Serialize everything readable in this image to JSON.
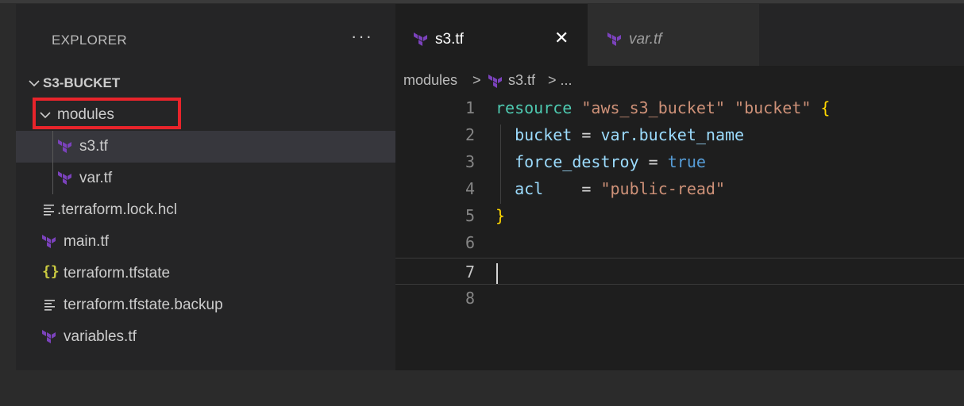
{
  "sidebar": {
    "title": "EXPLORER",
    "more_label": "···",
    "root_folder": "S3-BUCKET",
    "tree": [
      {
        "label": "modules",
        "kind": "folder",
        "expanded": true,
        "highlighted": true
      },
      {
        "label": "s3.tf",
        "kind": "terraform",
        "selected": true
      },
      {
        "label": "var.tf",
        "kind": "terraform"
      },
      {
        "label": ".terraform.lock.hcl",
        "kind": "text"
      },
      {
        "label": "main.tf",
        "kind": "terraform"
      },
      {
        "label": "terraform.tfstate",
        "kind": "json"
      },
      {
        "label": "terraform.tfstate.backup",
        "kind": "text"
      },
      {
        "label": "variables.tf",
        "kind": "terraform"
      }
    ]
  },
  "tabs": [
    {
      "label": "s3.tf",
      "active": true,
      "close_label": "✕"
    },
    {
      "label": "var.tf",
      "active": false
    }
  ],
  "breadcrumb": {
    "folder": "modules",
    "sep": ">",
    "file": "s3.tf",
    "rest": "> ..."
  },
  "code": {
    "current_line": 7,
    "lines": [
      {
        "n": "1"
      },
      {
        "n": "2"
      },
      {
        "n": "3"
      },
      {
        "n": "4"
      },
      {
        "n": "5"
      },
      {
        "n": "6"
      },
      {
        "n": "7"
      },
      {
        "n": "8"
      }
    ],
    "tokens": {
      "l1_kw": "resource",
      "l1_s1": "\"aws_s3_bucket\"",
      "l1_s2": "\"bucket\"",
      "l1_brace": "{",
      "l2_prop": "bucket",
      "l2_eq": " = ",
      "l2_val": "var.bucket_name",
      "l3_prop": "force_destroy",
      "l3_eq": " = ",
      "l3_val": "true",
      "l4_prop": "acl",
      "l4_eq": "    = ",
      "l4_val": "\"public-read\"",
      "l5_brace": "}"
    }
  },
  "colors": {
    "highlight_box": "#e8242b",
    "terraform_icon": "#7b42bc",
    "json_icon": "#cbcb41"
  }
}
